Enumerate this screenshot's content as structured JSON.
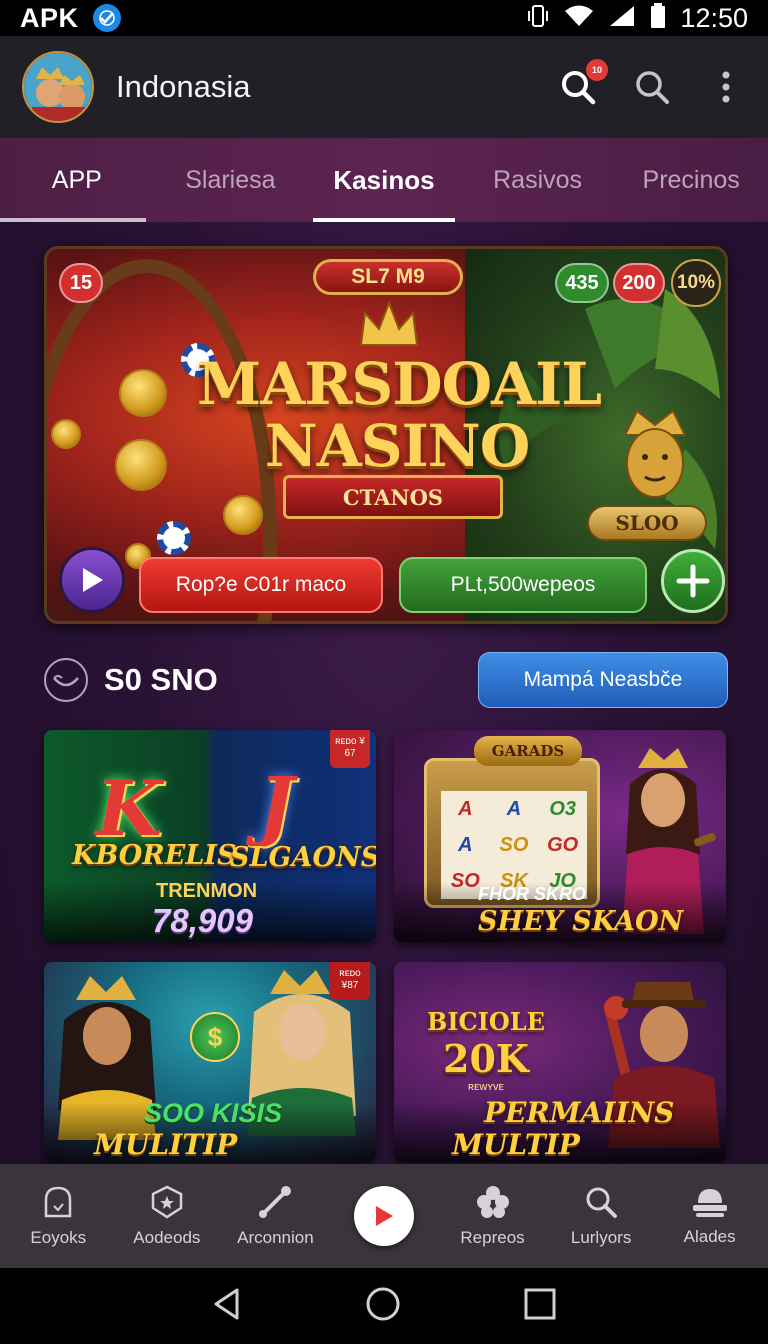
{
  "status_bar": {
    "carrier": "APK",
    "time": "12:50"
  },
  "header": {
    "title": "Indonasia",
    "notification_badge": "10"
  },
  "tabs": [
    {
      "label": "APP",
      "selected": false
    },
    {
      "label": "Slariesa",
      "selected": false
    },
    {
      "label": "Kasinos",
      "selected": true
    },
    {
      "label": "Rasivos",
      "selected": false
    },
    {
      "label": "Precinos",
      "selected": false
    }
  ],
  "banner": {
    "top_tag": "SL7 M9",
    "badge_left": "15",
    "badge_green": "435",
    "badge_red": "200",
    "badge_percent": "10%",
    "title_line1": "MARSDOAIL",
    "title_line2": "NASINO",
    "ribbon": "CTANOS",
    "mascot_label": "SLOO",
    "red_button": "Rop?e C01r maco",
    "green_button": "PLt,500wepeos"
  },
  "section": {
    "title": "S0 SNO",
    "button": "Mampá Neasbče"
  },
  "cards": [
    {
      "corner": "ʀᴇᴅᴏ ¥ 67",
      "left_logo": "KBORELIS",
      "right_logo": "SLGAONS",
      "label": "TRENMON",
      "number": "78,909"
    },
    {
      "slot_title": "GARADS",
      "label": "FHOR SKRO",
      "big": "SHEY SKAON",
      "reels": [
        "A",
        "A",
        "O3",
        "A",
        "SO",
        "GO",
        "SO",
        "SK",
        "JO"
      ]
    },
    {
      "corner": "ʀᴇᴅᴏ ¥87",
      "big1": "SOO KISIS",
      "big2": "MULITIP BAIGANT"
    },
    {
      "top_line1": "BICIOLE",
      "top_line2": "20K",
      "top_line3": "ʀᴇᴡʏᴠᴇ",
      "big1": "PERMAIINS",
      "big2": "MULTIP BAIIKER"
    }
  ],
  "bottom_nav": [
    {
      "label": "Eoyoks",
      "icon": "bell-outline-icon"
    },
    {
      "label": "Aodeods",
      "icon": "badge-star-icon"
    },
    {
      "label": "Arconnion",
      "icon": "joystick-icon"
    },
    {
      "label": "",
      "icon": "play-icon"
    },
    {
      "label": "Repreos",
      "icon": "flower-icon"
    },
    {
      "label": "Lurlyors",
      "icon": "search-icon"
    },
    {
      "label": "Alades",
      "icon": "profile-icon"
    }
  ],
  "colors": {
    "accent_red": "#e53935",
    "accent_green": "#2e8b2e",
    "accent_blue": "#2f74d0",
    "gold": "#ffd35a",
    "tab_bar": "#5c2451"
  }
}
